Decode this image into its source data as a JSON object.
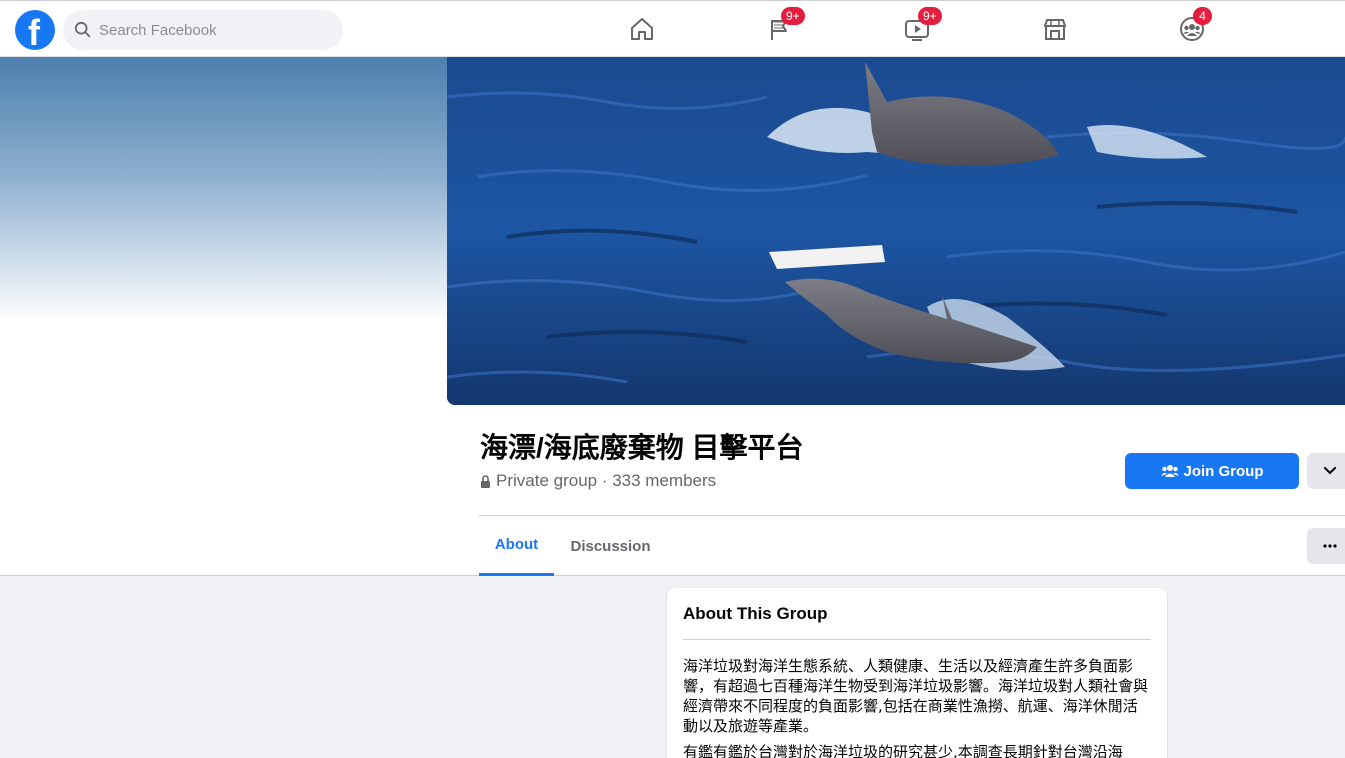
{
  "search": {
    "placeholder": "Search Facebook"
  },
  "nav": {
    "pages_badge": "9+",
    "watch_badge": "9+",
    "groups_badge": "4"
  },
  "group": {
    "title": "海漂/海底廢棄物 目擊平台",
    "meta": "Private group · 333 members",
    "join_label": "Join Group"
  },
  "tabs": [
    {
      "label": "About"
    },
    {
      "label": "Discussion"
    }
  ],
  "about": {
    "title": "About This Group",
    "paragraph1": "海洋垃圾對海洋生態系統、人類健康、生活以及經濟產生許多負面影響，有超過七百種海洋生物受到海洋垃圾影響。海洋垃圾對人類社會與經濟帶來不同程度的負面影響,包括在商業性漁撈、航運、海洋休閒活動以及旅遊等產業。",
    "paragraph2": "有鑑有鑑於台灣對於海洋垃圾的研究甚少,本調查長期針對台灣沿海"
  },
  "colors": {
    "brand": "#1877f2",
    "badge": "#e41e3f"
  }
}
